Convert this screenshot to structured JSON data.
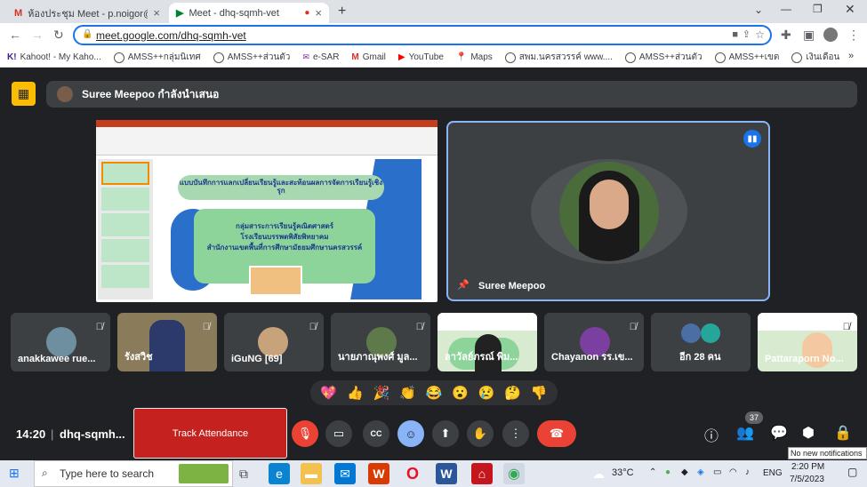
{
  "browser": {
    "tabs": [
      {
        "title": "ห้องประชุม Meet - p.noigor@gmail",
        "icon": "gmail-icon"
      },
      {
        "title": "Meet - dhq-sqmh-vet",
        "icon": "meet-icon"
      }
    ],
    "url": "meet.google.com/dhq-sqmh-vet",
    "bookmarks": [
      "Kahoot! - My Kaho...",
      "AMSS++กลุ่มนิเทศ",
      "AMSS++ส่วนตัว",
      "e-SAR",
      "Gmail",
      "YouTube",
      "Maps",
      "สพม.นครสวรรค์ www....",
      "AMSS++ส่วนตัว",
      "AMSS++เขต",
      "เงินเดือน"
    ]
  },
  "meet": {
    "presenter_text": "Suree Meepoo กำลังนำเสนอ",
    "slide": {
      "title": "แบบบันทึกการแลกเปลี่ยนเรียนรู้และสะท้อนผลการจัดการเรียนรู้เชิงรุก",
      "line1": "กลุ่มสาระการเรียนรู้คณิตศาสตร์",
      "line2": "โรงเรียนบรรพตพิสัยพิทยาคม",
      "line3": "สำนักงานเขตพื้นที่การศึกษามัธยมศึกษานครสวรรค์"
    },
    "speaker_name": "Suree Meepoo",
    "participants": [
      "anakkawee rue...",
      "รังสวิช",
      "iGuNG [69]",
      "นายภาณุพงศ์ มูล...",
      "ลาวัลย์ภรณ์ พิม...",
      "Chayanon รร.เข...",
      "อีก 28 คน",
      "Pattaraporn No..."
    ],
    "reactions": [
      "💖",
      "👍",
      "🎉",
      "👏",
      "😂",
      "😮",
      "😢",
      "🤔",
      "👎"
    ],
    "time": "14:20",
    "code": "dhq-sqmh...",
    "track_attendance": "Track Attendance",
    "people_count": "37"
  },
  "taskbar": {
    "search_placeholder": "Type here to search",
    "weather": "33°C",
    "lang": "ENG",
    "time": "2:20 PM",
    "date": "7/5/2023",
    "notification": "No new notifications"
  }
}
